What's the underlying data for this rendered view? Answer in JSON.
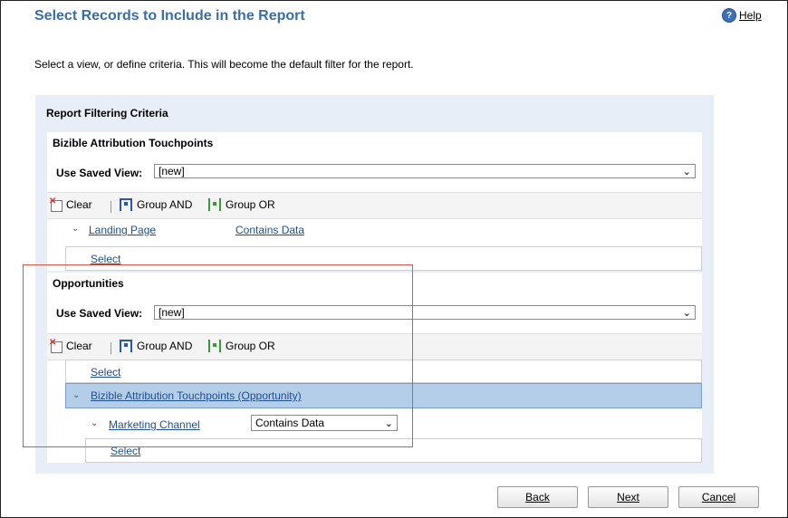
{
  "header": {
    "title": "Select Records to Include in the Report",
    "help_label": "Help",
    "instructions": "Select a view, or define criteria. This will become the default filter for the report."
  },
  "panel": {
    "title": "Report Filtering Criteria"
  },
  "section1": {
    "title": "Bizible Attribution Touchpoints",
    "saved_view_label": "Use Saved View:",
    "saved_view_value": "[new]",
    "toolbar": {
      "clear": "Clear",
      "group_and": "Group AND",
      "group_or": "Group OR"
    },
    "condition": {
      "field": "Landing Page",
      "operator": "Contains Data"
    },
    "select_label": "Select"
  },
  "section2": {
    "title": "Opportunities",
    "saved_view_label": "Use Saved View:",
    "saved_view_value": "[new]",
    "toolbar": {
      "clear": "Clear",
      "group_and": "Group AND",
      "group_or": "Group OR"
    },
    "select_label": "Select",
    "related_entity": "Bizible Attribution Touchpoints (Opportunity)",
    "condition": {
      "field": "Marketing Channel",
      "operator": "Contains Data"
    },
    "nested_select_label": "Select"
  },
  "buttons": {
    "back": "Back",
    "next": "Next",
    "cancel": "Cancel"
  },
  "colors": {
    "title": "#3a6fa6",
    "panel_bg": "#e8eef7",
    "highlight": "#b4cde9",
    "annotation_box": "#d9584a"
  }
}
